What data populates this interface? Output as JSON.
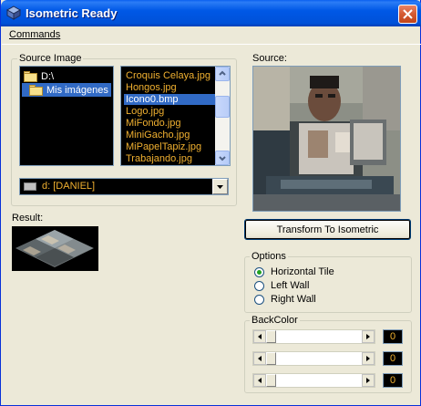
{
  "window": {
    "title": "Isometric Ready",
    "close_label": "close"
  },
  "menu": {
    "commands": "Commands"
  },
  "source_group": {
    "legend": "Source Image",
    "tree": [
      {
        "label": "D:\\",
        "selected": false
      },
      {
        "label": "Mis imágenes",
        "selected": true
      }
    ],
    "files": [
      {
        "name": "Croquis Celaya.jpg",
        "selected": false
      },
      {
        "name": "Hongos.jpg",
        "selected": false
      },
      {
        "name": "Icono0.bmp",
        "selected": true
      },
      {
        "name": "Logo.jpg",
        "selected": false
      },
      {
        "name": "MiFondo.jpg",
        "selected": false
      },
      {
        "name": "MiniGacho.jpg",
        "selected": false
      },
      {
        "name": "MiPapelTapiz.jpg",
        "selected": false
      },
      {
        "name": "Trabajando.jpg",
        "selected": false
      }
    ],
    "drive": "d: [DANIEL]"
  },
  "result": {
    "label": "Result:"
  },
  "source": {
    "label": "Source:"
  },
  "actions": {
    "transform": "Transform To Isometric"
  },
  "options": {
    "legend": "Options",
    "items": [
      {
        "label": "Horizontal Tile",
        "checked": true
      },
      {
        "label": "Left Wall",
        "checked": false
      },
      {
        "label": "Right Wall",
        "checked": false
      }
    ]
  },
  "backcolor": {
    "legend": "BackColor",
    "values": [
      "0",
      "0",
      "0"
    ]
  },
  "colors": {
    "title_blue": "#0058e6",
    "selection": "#316ac5",
    "list_text": "#f0b030"
  }
}
